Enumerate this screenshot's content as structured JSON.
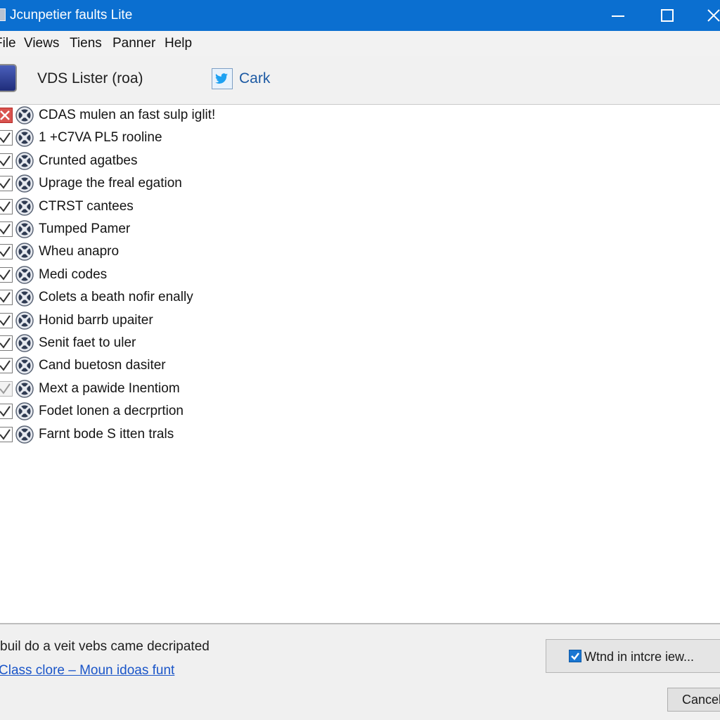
{
  "window": {
    "title": "Jcunpetier faults Lite",
    "controls": {
      "minimize": "minimize-icon",
      "maximize": "maximize-icon",
      "close": "close-icon"
    },
    "accent_color": "#0b6fd0"
  },
  "menubar": {
    "items": [
      {
        "label": "File"
      },
      {
        "label": "Views"
      },
      {
        "label": "Tiens"
      },
      {
        "label": "Panner"
      },
      {
        "label": "Help"
      }
    ]
  },
  "toolbar": {
    "title": "VDS Lister (roa)",
    "app_icon": "app-book-icon",
    "link_icon": "twitter-bird-icon",
    "link_label": "Cark"
  },
  "list": {
    "items": [
      {
        "label": "CDAS mulen an fast sulp iglit!",
        "state": "error"
      },
      {
        "label": "1 +C7VA PL5 rooline",
        "state": "checked"
      },
      {
        "label": "Crunted agatbes",
        "state": "checked"
      },
      {
        "label": "Uprage the freal egation",
        "state": "checked"
      },
      {
        "label": "CTRST cantees",
        "state": "checked"
      },
      {
        "label": "Tumped Pamer",
        "state": "checked"
      },
      {
        "label": "Wheu anapro",
        "state": "checked"
      },
      {
        "label": "Medi codes",
        "state": "checked"
      },
      {
        "label": "Colets a beath nofir enally",
        "state": "checked"
      },
      {
        "label": "Honid barrb upaiter",
        "state": "checked"
      },
      {
        "label": "Senit faet to uler",
        "state": "checked"
      },
      {
        "label": "Cand buetosn dasiter",
        "state": "checked"
      },
      {
        "label": "Mext a pawide Inentiom",
        "state": "faint"
      },
      {
        "label": "Fodet lonen a decrprtion",
        "state": "checked"
      },
      {
        "label": "Farnt bode S itten trals",
        "state": "checked"
      }
    ]
  },
  "footer": {
    "description": "buil do a veit vebs came decripated",
    "link": "Class clore – Moun idoas funt",
    "option_label": "Wtnd in intcre iew...",
    "option_checked": true,
    "cancel_label": "Cancel"
  }
}
